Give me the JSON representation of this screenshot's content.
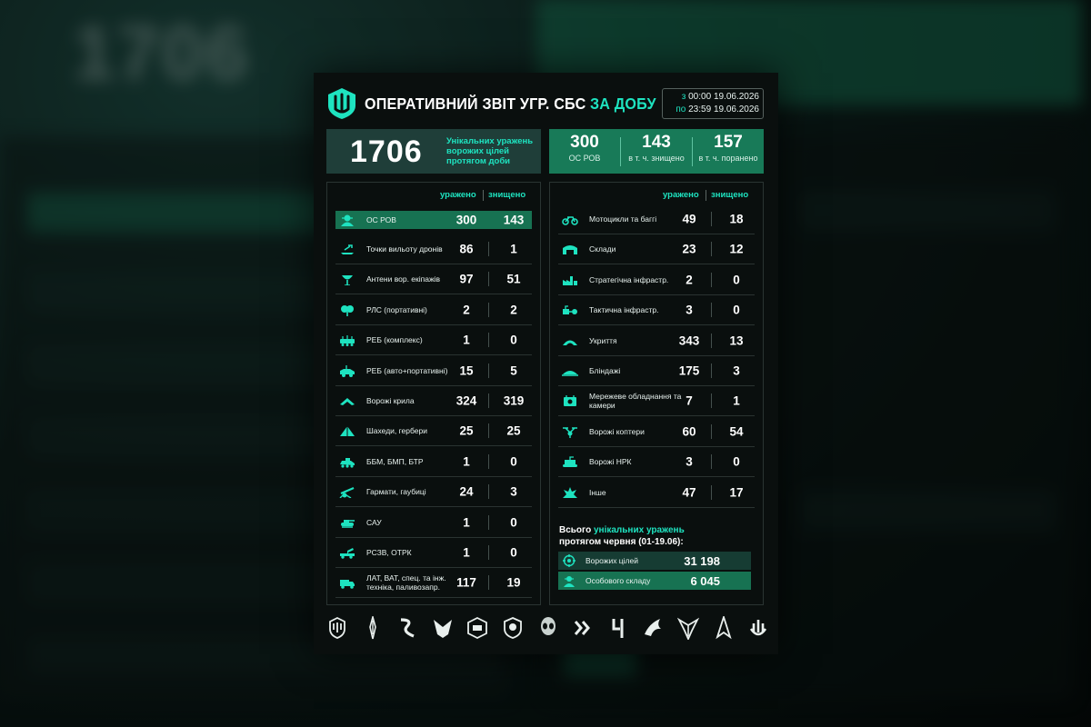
{
  "header": {
    "title_main": "ОПЕРАТИВНИЙ ЗВІТ УГР. СБС",
    "title_accent": "ЗА ДОБУ",
    "period": {
      "from_prefix": "з",
      "from_time": "00:00",
      "from_date": "19.06.2026",
      "to_prefix": "по",
      "to_time": "23:59",
      "to_date": "19.06.2026"
    }
  },
  "summary": {
    "total": "1706",
    "total_desc": "Унікальних уражень ворожих цілей протягом доби",
    "stats": [
      {
        "value": "300",
        "label": "ОС РОВ"
      },
      {
        "value": "143",
        "label": "в т. ч. знищено"
      },
      {
        "value": "157",
        "label": "в т. ч. поранено"
      }
    ]
  },
  "columns": {
    "hit": "уражено",
    "destroyed": "знищено"
  },
  "left_rows": [
    {
      "icon": "soldier-icon",
      "label": "ОС РОВ",
      "hit": "300",
      "destroyed": "143",
      "highlight": true
    },
    {
      "icon": "drone-launch-icon",
      "label": "Точки вильоту дронів",
      "hit": "86",
      "destroyed": "1"
    },
    {
      "icon": "antenna-icon",
      "label": "Антени вор. екіпажів",
      "hit": "97",
      "destroyed": "51"
    },
    {
      "icon": "radio-icon",
      "label": "РЛС (портативні)",
      "hit": "2",
      "destroyed": "2"
    },
    {
      "icon": "ew-complex-icon",
      "label": "РЕБ (комплекс)",
      "hit": "1",
      "destroyed": "0"
    },
    {
      "icon": "ew-vehicle-icon",
      "label": "РЕБ (авто+портативні)",
      "hit": "15",
      "destroyed": "5"
    },
    {
      "icon": "wings-icon",
      "label": "Ворожі крила",
      "hit": "324",
      "destroyed": "319"
    },
    {
      "icon": "shahed-icon",
      "label": "Шахеди, гербери",
      "hit": "25",
      "destroyed": "25"
    },
    {
      "icon": "bmp-icon",
      "label": "ББМ, БМП, БТР",
      "hit": "1",
      "destroyed": "0"
    },
    {
      "icon": "howitzer-icon",
      "label": "Гармати, гаубиці",
      "hit": "24",
      "destroyed": "3"
    },
    {
      "icon": "sau-icon",
      "label": "САУ",
      "hit": "1",
      "destroyed": "0"
    },
    {
      "icon": "mlrs-icon",
      "label": "РСЗВ, ОТРК",
      "hit": "1",
      "destroyed": "0"
    },
    {
      "icon": "truck-icon",
      "label": "ЛАТ, ВАТ, спец. та інж. техніка, паливозапр.",
      "hit": "117",
      "destroyed": "19"
    }
  ],
  "right_rows": [
    {
      "icon": "motorcycle-icon",
      "label": "Мотоцикли та баггі",
      "hit": "49",
      "destroyed": "18"
    },
    {
      "icon": "warehouse-icon",
      "label": "Склади",
      "hit": "23",
      "destroyed": "12"
    },
    {
      "icon": "factory-icon",
      "label": "Стратегічна інфрастр.",
      "hit": "2",
      "destroyed": "0"
    },
    {
      "icon": "tactical-infra-icon",
      "label": "Тактична інфрастр.",
      "hit": "3",
      "destroyed": "0"
    },
    {
      "icon": "shelter-icon",
      "label": "Укриття",
      "hit": "343",
      "destroyed": "13"
    },
    {
      "icon": "dugout-icon",
      "label": "Бліндажі",
      "hit": "175",
      "destroyed": "3"
    },
    {
      "icon": "network-camera-icon",
      "label": "Мережеве обладнання та камери",
      "hit": "7",
      "destroyed": "1"
    },
    {
      "icon": "copter-icon",
      "label": "Ворожі коптери",
      "hit": "60",
      "destroyed": "54"
    },
    {
      "icon": "ugv-icon",
      "label": "Ворожі НРК",
      "hit": "3",
      "destroyed": "0"
    },
    {
      "icon": "explosion-icon",
      "label": "Інше",
      "hit": "47",
      "destroyed": "17"
    }
  ],
  "totals": {
    "line1_a": "Всього",
    "line1_b": "унікальних уражень",
    "line2": "протягом червня (01-19.06):",
    "items": [
      {
        "icon": "target-icon",
        "label": "Ворожих цілей",
        "value": "31 198"
      },
      {
        "icon": "soldier-icon",
        "label": "Особового складу",
        "value": "6 045"
      }
    ]
  },
  "colors": {
    "accent": "#1ee3c0",
    "green": "#187a58",
    "highlight": "#177252",
    "card": "#0a0f0e"
  },
  "emblems": [
    "trident-emblem-icon",
    "sword-emblem-icon",
    "wave-emblem-icon",
    "bird-emblem-icon",
    "cube-emblem-icon",
    "shield-emblem-icon",
    "alien-emblem-icon",
    "chevron-emblem-icon",
    "number-emblem-icon",
    "dragon-emblem-icon",
    "falcon-emblem-icon",
    "rocket-emblem-icon",
    "hand-emblem-icon"
  ]
}
